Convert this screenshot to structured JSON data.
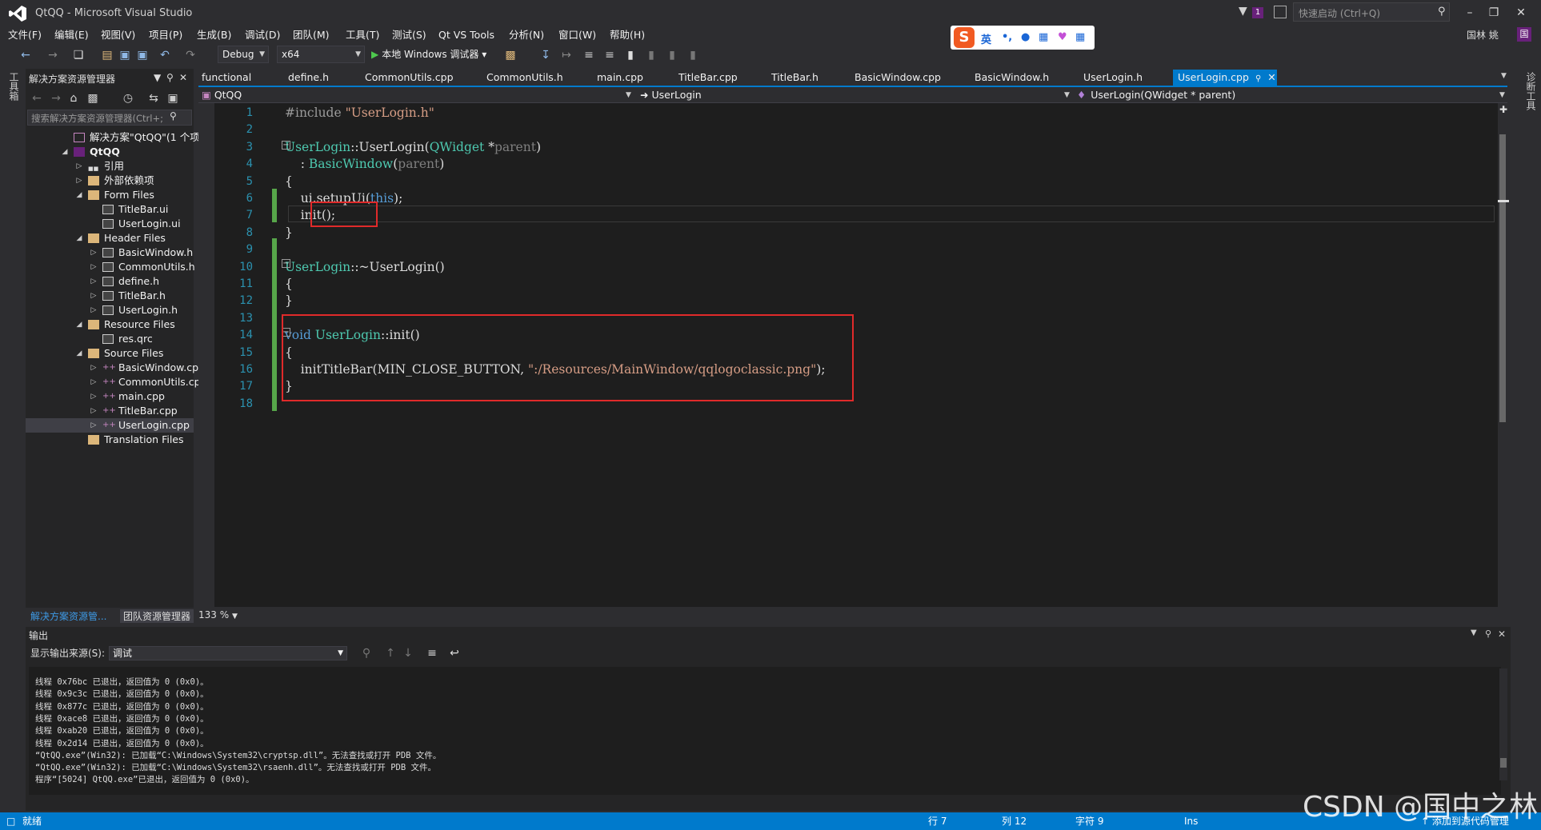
{
  "window": {
    "title": "QtQQ - Microsoft Visual Studio",
    "quick_launch_placeholder": "快速启动 (Ctrl+Q)",
    "notification_count": "1",
    "user_name": "国林 姚",
    "user_initial": "国"
  },
  "menu": [
    "文件(F)",
    "编辑(E)",
    "视图(V)",
    "项目(P)",
    "生成(B)",
    "调试(D)",
    "团队(M)",
    "工具(T)",
    "测试(S)",
    "Qt VS Tools",
    "分析(N)",
    "窗口(W)",
    "帮助(H)"
  ],
  "ime": {
    "logo": "S",
    "lang": "英"
  },
  "toolbar": {
    "config": "Debug",
    "platform": "x64",
    "run_label": "本地 Windows 调试器"
  },
  "left_rail_label": "工具箱",
  "right_rail_label": "诊断工具",
  "solution_explorer": {
    "title": "解决方案资源管理器",
    "search_placeholder": "搜索解决方案资源管理器(Ctrl+;",
    "items": [
      {
        "label": "解决方案\"QtQQ\"(1 个项目)",
        "depth": 0,
        "expander": "",
        "icon": "solution-icon"
      },
      {
        "label": "QtQQ",
        "depth": 0,
        "expander": "◢",
        "icon": "project-icon",
        "bold": true
      },
      {
        "label": "引用",
        "depth": 1,
        "expander": "▷",
        "icon": "references-icon"
      },
      {
        "label": "外部依赖项",
        "depth": 1,
        "expander": "▷",
        "icon": "folder-icon"
      },
      {
        "label": "Form Files",
        "depth": 1,
        "expander": "◢",
        "icon": "folder-icon"
      },
      {
        "label": "TitleBar.ui",
        "depth": 2,
        "expander": "",
        "icon": "file-icon"
      },
      {
        "label": "UserLogin.ui",
        "depth": 2,
        "expander": "",
        "icon": "file-icon"
      },
      {
        "label": "Header Files",
        "depth": 1,
        "expander": "◢",
        "icon": "folder-icon"
      },
      {
        "label": "BasicWindow.h",
        "depth": 2,
        "expander": "▷",
        "icon": "header-file-icon"
      },
      {
        "label": "CommonUtils.h",
        "depth": 2,
        "expander": "▷",
        "icon": "header-file-icon"
      },
      {
        "label": "define.h",
        "depth": 2,
        "expander": "▷",
        "icon": "header-file-icon"
      },
      {
        "label": "TitleBar.h",
        "depth": 2,
        "expander": "▷",
        "icon": "header-file-icon"
      },
      {
        "label": "UserLogin.h",
        "depth": 2,
        "expander": "▷",
        "icon": "header-file-icon"
      },
      {
        "label": "Resource Files",
        "depth": 1,
        "expander": "◢",
        "icon": "folder-icon"
      },
      {
        "label": "res.qrc",
        "depth": 2,
        "expander": "",
        "icon": "file-icon"
      },
      {
        "label": "Source Files",
        "depth": 1,
        "expander": "◢",
        "icon": "folder-icon"
      },
      {
        "label": "BasicWindow.cpp",
        "depth": 2,
        "expander": "▷",
        "icon": "cpp-file-icon"
      },
      {
        "label": "CommonUtils.cpp",
        "depth": 2,
        "expander": "▷",
        "icon": "cpp-file-icon"
      },
      {
        "label": "main.cpp",
        "depth": 2,
        "expander": "▷",
        "icon": "cpp-file-icon"
      },
      {
        "label": "TitleBar.cpp",
        "depth": 2,
        "expander": "▷",
        "icon": "cpp-file-icon"
      },
      {
        "label": "UserLogin.cpp",
        "depth": 2,
        "expander": "▷",
        "icon": "cpp-file-icon",
        "selected": true
      },
      {
        "label": "Translation Files",
        "depth": 1,
        "expander": "",
        "icon": "folder-icon"
      }
    ],
    "bottom_tabs": [
      "解决方案资源管...",
      "团队资源管理器"
    ]
  },
  "editor": {
    "tabs": [
      "functional",
      "define.h",
      "CommonUtils.cpp",
      "CommonUtils.h",
      "main.cpp",
      "TitleBar.cpp",
      "TitleBar.h",
      "BasicWindow.cpp",
      "BasicWindow.h",
      "UserLogin.h",
      "UserLogin.cpp"
    ],
    "active_tab": "UserLogin.cpp",
    "nav_project": "QtQQ",
    "nav_class": "UserLogin",
    "nav_member": "UserLogin(QWidget * parent)",
    "zoom": "133 %",
    "lines": [
      [
        {
          "t": "#include ",
          "c": "#9b9b9b"
        },
        {
          "t": "\"UserLogin.h\"",
          "c": "#d69d85"
        }
      ],
      [],
      [
        {
          "t": "UserLogin",
          "c": "#4ec9b0"
        },
        {
          "t": "::",
          "c": "#dcdcdc"
        },
        {
          "t": "UserLogin",
          "c": "#dcdcdc"
        },
        {
          "t": "(",
          "c": "#dcdcdc"
        },
        {
          "t": "QWidget",
          "c": "#4ec9b0"
        },
        {
          "t": " *",
          "c": "#dcdcdc"
        },
        {
          "t": "parent",
          "c": "#7f7f7f"
        },
        {
          "t": ")",
          "c": "#dcdcdc"
        }
      ],
      [
        {
          "t": "    : ",
          "c": "#dcdcdc"
        },
        {
          "t": "BasicWindow",
          "c": "#4ec9b0"
        },
        {
          "t": "(",
          "c": "#dcdcdc"
        },
        {
          "t": "parent",
          "c": "#7f7f7f"
        },
        {
          "t": ")",
          "c": "#dcdcdc"
        }
      ],
      [
        {
          "t": "{",
          "c": "#dcdcdc"
        }
      ],
      [
        {
          "t": "    ui.setupUi(",
          "c": "#dcdcdc"
        },
        {
          "t": "this",
          "c": "#569cd6"
        },
        {
          "t": ");",
          "c": "#dcdcdc"
        }
      ],
      [
        {
          "t": "    init();",
          "c": "#dcdcdc"
        }
      ],
      [
        {
          "t": "}",
          "c": "#dcdcdc"
        }
      ],
      [],
      [
        {
          "t": "UserLogin",
          "c": "#4ec9b0"
        },
        {
          "t": "::~UserLogin()",
          "c": "#dcdcdc"
        }
      ],
      [
        {
          "t": "{",
          "c": "#dcdcdc"
        }
      ],
      [
        {
          "t": "}",
          "c": "#dcdcdc"
        }
      ],
      [],
      [
        {
          "t": "void ",
          "c": "#569cd6"
        },
        {
          "t": "UserLogin",
          "c": "#4ec9b0"
        },
        {
          "t": "::init()",
          "c": "#dcdcdc"
        }
      ],
      [
        {
          "t": "{",
          "c": "#dcdcdc"
        }
      ],
      [
        {
          "t": "    initTitleBar(MIN_CLOSE_BUTTON, ",
          "c": "#dcdcdc"
        },
        {
          "t": "\":/Resources/MainWindow/qqlogoclassic.png\"",
          "c": "#d69d85"
        },
        {
          "t": ");",
          "c": "#dcdcdc"
        }
      ],
      [
        {
          "t": "}",
          "c": "#dcdcdc"
        }
      ],
      []
    ]
  },
  "output": {
    "title": "输出",
    "source_label": "显示输出来源(S):",
    "source_value": "调试",
    "lines": [
      "线程 0x76bc 已退出，返回值为 0 (0x0)。",
      "线程 0x9c3c 已退出，返回值为 0 (0x0)。",
      "线程 0x877c 已退出，返回值为 0 (0x0)。",
      "线程 0xace8 已退出，返回值为 0 (0x0)。",
      "线程 0xab20 已退出，返回值为 0 (0x0)。",
      "线程 0x2d14 已退出，返回值为 0 (0x0)。",
      "“QtQQ.exe”(Win32): 已加载“C:\\Windows\\System32\\cryptsp.dll”。无法查找或打开 PDB 文件。",
      "“QtQQ.exe”(Win32): 已加载“C:\\Windows\\System32\\rsaenh.dll”。无法查找或打开 PDB 文件。",
      "程序“[5024] QtQQ.exe”已退出，返回值为 0 (0x0)。"
    ]
  },
  "status": {
    "ready": "就绪",
    "row": "行 7",
    "col": "列 12",
    "char": "字符 9",
    "ins": "Ins",
    "add_source": "添加到源代码管理"
  },
  "watermark": "CSDN @国中之林"
}
